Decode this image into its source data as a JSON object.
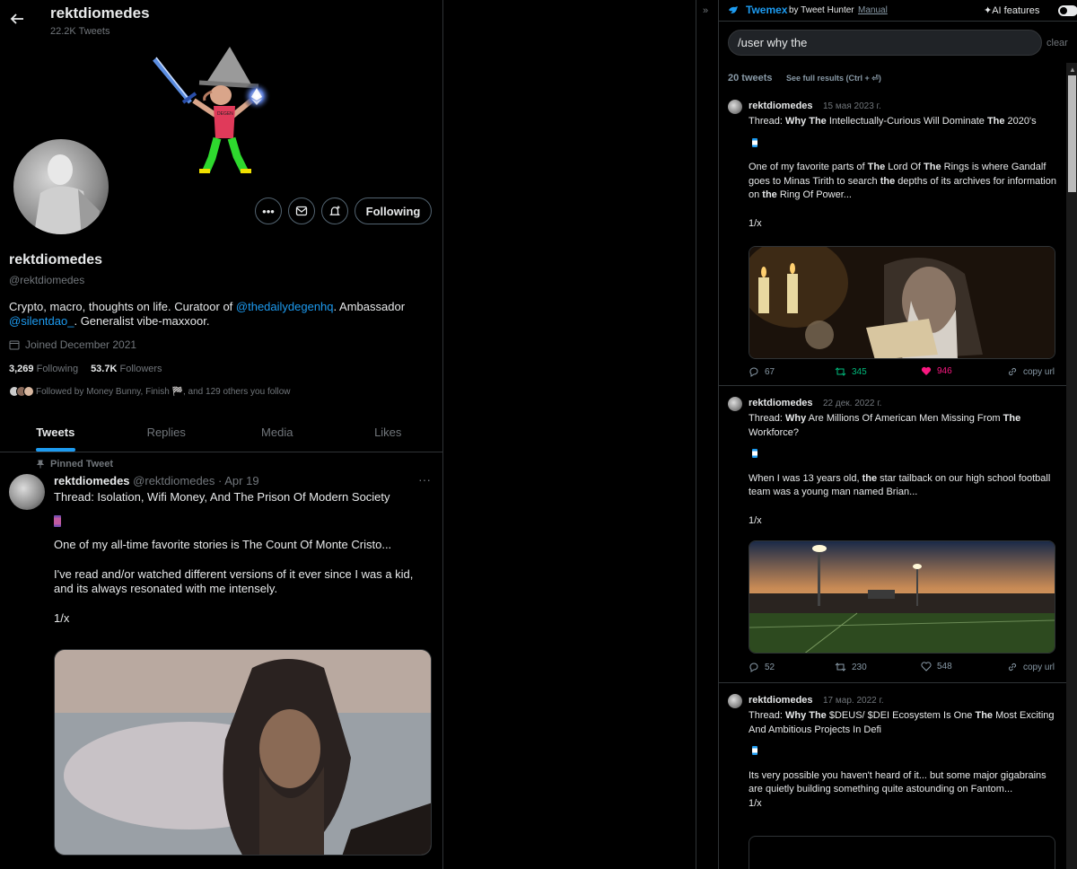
{
  "profile": {
    "topbar_name": "rektdiomedes",
    "tweet_count": "22.2K Tweets",
    "name": "rektdiomedes",
    "handle": "@rektdiomedes",
    "bio_pre": "Crypto, macro, thoughts on life. Curatoor of ",
    "bio_link1": "@thedailydegenhq",
    "bio_mid": ". Ambassador ",
    "bio_link2": "@silentdao_",
    "bio_post": ". Generalist vibe-maxxoor.",
    "joined": "Joined December 2021",
    "following_count": "3,269",
    "following_label": "Following",
    "followers_count": "53.7K",
    "followers_label": "Followers",
    "followed_by": "Followed by Money Bunny, Finish 🏁, and 129 others you follow",
    "follow_button": "Following",
    "more_icon": "more-icon",
    "message_icon": "mail-icon",
    "notify_icon": "notification-bell-icon"
  },
  "tabs": [
    "Tweets",
    "Replies",
    "Media",
    "Likes"
  ],
  "pinned_tweet": {
    "pinned_label": "Pinned Tweet",
    "author": "rektdiomedes",
    "meta": "@rektdiomedes · Apr 19",
    "line1": "Thread: Isolation, Wifi Money, And The Prison Of Modern Society",
    "line2": "One of my all-time favorite stories is The Count Of Monte Cristo...",
    "line3": "I've read and/or watched different versions of it ever since I was a kid, and its always resonated with me intensely.",
    "line4": "1/x"
  },
  "twemex": {
    "brand": "Twemex",
    "by": "by Tweet Hunter",
    "manual": "Manual",
    "ai_features": "✦AI features",
    "search_value": "/user why the",
    "clear": "clear",
    "count": "20 tweets",
    "see_full": "See full results (Ctrl + ⏎)",
    "collapse": "»",
    "results": [
      {
        "author": "rektdiomedes",
        "date": "15 мая 2023 г.",
        "body_a": "One of my favorite parts of ",
        "body_b": "The",
        "body_c": " Lord Of ",
        "body_d": "The",
        "body_e": " Rings is where Gandalf goes to Minas Tirith to search ",
        "body_f": "the",
        "body_g": " depths of its archives for information on ",
        "body_h": "the",
        "body_i": " Ring Of Power...",
        "footer": "1/x",
        "replies": "67",
        "retweets": "345",
        "likes": "946",
        "copy": "copy url"
      },
      {
        "author": "rektdiomedes",
        "date": "22 дек. 2022 г.",
        "body_a": "When I was 13 years old, ",
        "body_b": "the",
        "body_c": " star tailback on our high school football team was a young man named Brian...",
        "footer": "1/x",
        "replies": "52",
        "retweets": "230",
        "likes": "548",
        "copy": "copy url"
      },
      {
        "author": "rektdiomedes",
        "date": "17 мар. 2022 г.",
        "body": "Its very possible you haven't heard of it... but some major gigabrains are quietly building something quite astounding on Fantom...",
        "footer": "1/x"
      }
    ]
  },
  "colors": {
    "accent": "#1d9bf0",
    "retweet": "#00ba7c",
    "like": "#f91880",
    "background": "#000000"
  }
}
